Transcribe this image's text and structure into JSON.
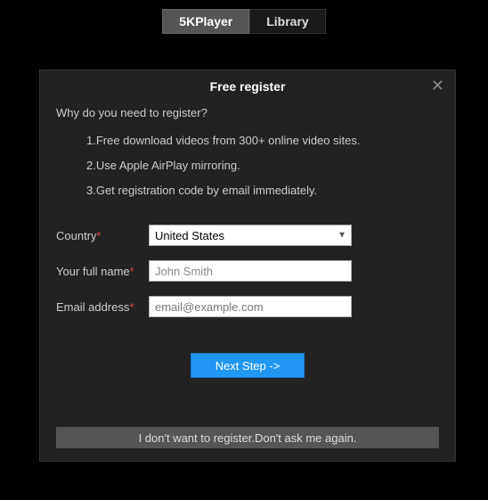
{
  "tabs": {
    "player": "5KPlayer",
    "library": "Library"
  },
  "dialog": {
    "title": "Free register",
    "why_heading": "Why do you need to register?",
    "benefits": {
      "b1": "1.Free download videos from 300+ online video sites.",
      "b2": "2.Use Apple AirPlay mirroring.",
      "b3": "3.Get registration code by email immediately."
    },
    "labels": {
      "country": "Country",
      "fullname": "Your full name",
      "email": "Email address"
    },
    "values": {
      "country": "United States",
      "fullname": "John Smith",
      "email_placeholder": "email@example.com"
    },
    "buttons": {
      "next": "Next Step ->",
      "skip": "I don't want to register.Don't ask me again."
    }
  }
}
